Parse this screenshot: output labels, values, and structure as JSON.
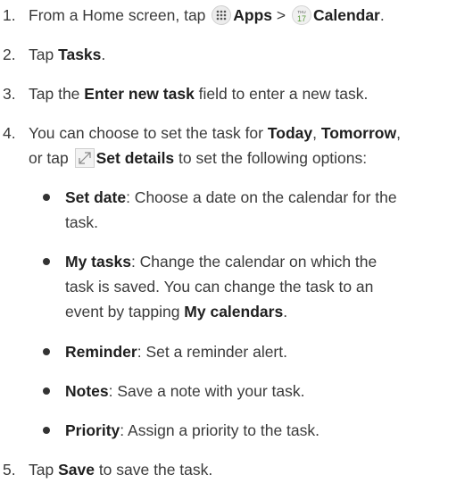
{
  "steps": [
    {
      "num": "1.",
      "pre": "From a Home screen, tap ",
      "apps_label": "Apps",
      "sep": " > ",
      "calendar_label": "Calendar",
      "post": "."
    },
    {
      "num": "2.",
      "pre": "Tap ",
      "bold": "Tasks",
      "post": "."
    },
    {
      "num": "3.",
      "pre": "Tap the ",
      "bold": "Enter new task",
      "post": " field to enter a new task."
    },
    {
      "num": "4.",
      "pre": "You can choose to set the task for ",
      "today": "Today",
      "comma": ", ",
      "tomorrow": "Tomorrow",
      "comma2": ",",
      "line2_pre": "or tap ",
      "set_details": "Set details",
      "line2_post": " to set the following options:"
    },
    {
      "num": "5.",
      "pre": "Tap ",
      "bold": "Save",
      "post": " to save the task."
    }
  ],
  "calendar_icon": {
    "day_abbr": "THU",
    "day_num": "17"
  },
  "bullets": [
    {
      "term": "Set date",
      "line1": ": Choose a date on the calendar for the",
      "line2": "task."
    },
    {
      "term": "My tasks",
      "line1": ": Change the calendar on which the",
      "line2": "task is saved. You can change the task to an",
      "line3_pre": "event by tapping ",
      "line3_bold": "My calendars",
      "line3_post": "."
    },
    {
      "term": "Reminder",
      "line1": ": Set a reminder alert."
    },
    {
      "term": "Notes",
      "line1": ": Save a note with your task."
    },
    {
      "term": "Priority",
      "line1": ": Assign a priority to the task."
    }
  ]
}
